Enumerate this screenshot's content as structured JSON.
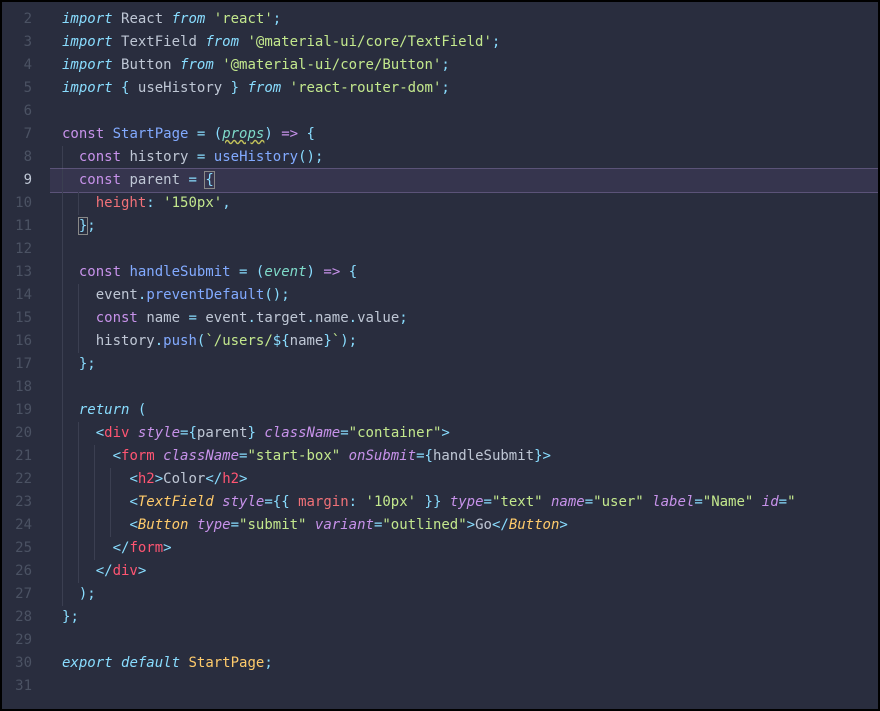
{
  "lines": [
    {
      "num": "2"
    },
    {
      "num": "3"
    },
    {
      "num": "4"
    },
    {
      "num": "5"
    },
    {
      "num": "6"
    },
    {
      "num": "7"
    },
    {
      "num": "8"
    },
    {
      "num": "9",
      "current": true
    },
    {
      "num": "10"
    },
    {
      "num": "11"
    },
    {
      "num": "12"
    },
    {
      "num": "13"
    },
    {
      "num": "14"
    },
    {
      "num": "15"
    },
    {
      "num": "16"
    },
    {
      "num": "17"
    },
    {
      "num": "18"
    },
    {
      "num": "19"
    },
    {
      "num": "20"
    },
    {
      "num": "21"
    },
    {
      "num": "22"
    },
    {
      "num": "23"
    },
    {
      "num": "24"
    },
    {
      "num": "25"
    },
    {
      "num": "26"
    },
    {
      "num": "27"
    },
    {
      "num": "28"
    },
    {
      "num": "29"
    },
    {
      "num": "30"
    },
    {
      "num": "31"
    }
  ],
  "tokens": {
    "import": "import",
    "from": "from",
    "export": "export",
    "default": "default",
    "return": "return",
    "const": "const",
    "React": "React",
    "TextField": "TextField",
    "Button": "Button",
    "useHistory": "useHistory",
    "StartPage": "StartPage",
    "history": "history",
    "parent": "parent",
    "height": "height",
    "handleSubmit": "handleSubmit",
    "event": "event",
    "preventDefault": "preventDefault",
    "name": "name",
    "target": "target",
    "value": "value",
    "push": "push",
    "props": "props",
    "div": "div",
    "form": "form",
    "h2": "h2",
    "style": "style",
    "className": "className",
    "onSubmit": "onSubmit",
    "margin": "margin",
    "type": "type",
    "variant": "variant",
    "label": "label",
    "id": "id"
  },
  "strings": {
    "react": "'react'",
    "muiTextField": "'@material-ui/core/TextField'",
    "muiButton": "'@material-ui/core/Button'",
    "routerDom": "'react-router-dom'",
    "px150": "'150px'",
    "usersPath": "/users/",
    "container": "\"container\"",
    "startBox": "\"start-box\"",
    "colorText": "Color",
    "px10": "'10px'",
    "text": "\"text\"",
    "user": "\"user\"",
    "Name": "\"Name\"",
    "submit": "\"submit\"",
    "outlined": "\"outlined\"",
    "Go": "Go"
  }
}
